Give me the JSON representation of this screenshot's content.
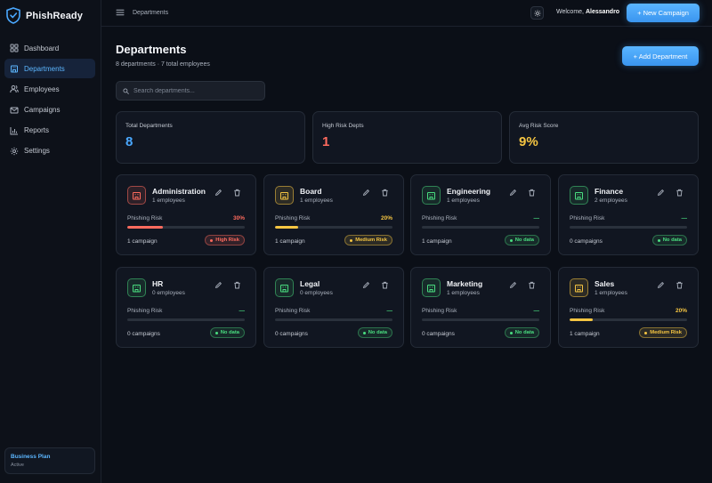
{
  "brand": {
    "name": "PhishReady"
  },
  "sidebar": {
    "items": [
      {
        "label": "Dashboard",
        "icon": "grid-icon"
      },
      {
        "label": "Departments",
        "icon": "building-icon"
      },
      {
        "label": "Employees",
        "icon": "users-icon"
      },
      {
        "label": "Campaigns",
        "icon": "mail-icon"
      },
      {
        "label": "Reports",
        "icon": "chart-icon"
      },
      {
        "label": "Settings",
        "icon": "gear-icon"
      }
    ],
    "active": "Departments",
    "plan": {
      "name": "Business Plan",
      "status": "Active"
    }
  },
  "topbar": {
    "breadcrumb": "Departments",
    "welcome_prefix": "Welcome,",
    "user": "Alessandro",
    "new_campaign_label": "+ New Campaign"
  },
  "page": {
    "title": "Departments",
    "subtitle": "8 departments · 7 total employees",
    "add_label": "+ Add Department",
    "search_placeholder": "Search departments..."
  },
  "stats": [
    {
      "label": "Total Departments",
      "value": "8",
      "color": "#4aa8ff"
    },
    {
      "label": "High Risk Depts",
      "value": "1",
      "color": "#ff6b5e"
    },
    {
      "label": "Avg Risk Score",
      "value": "9%",
      "color": "#f5c542"
    }
  ],
  "colors": {
    "accent": "#4aa8ff",
    "high": "#ff6b5e",
    "medium": "#f5c542",
    "none": "#4ade80"
  },
  "departments": [
    {
      "name": "Administration",
      "employees": "1 employees",
      "risk_label": "Phishing Risk",
      "risk_text": "30%",
      "risk": 0.3,
      "campaigns": "1 campaign",
      "badge": "High Risk",
      "level": "high"
    },
    {
      "name": "Board",
      "employees": "1 employees",
      "risk_label": "Phishing Risk",
      "risk_text": "20%",
      "risk": 0.2,
      "campaigns": "1 campaign",
      "badge": "Medium Risk",
      "level": "medium"
    },
    {
      "name": "Engineering",
      "employees": "1 employees",
      "risk_label": "Phishing Risk",
      "risk_text": "—",
      "risk": 0,
      "campaigns": "1 campaign",
      "badge": "No data",
      "level": "none"
    },
    {
      "name": "Finance",
      "employees": "2 employees",
      "risk_label": "Phishing Risk",
      "risk_text": "—",
      "risk": 0,
      "campaigns": "0 campaigns",
      "badge": "No data",
      "level": "none"
    },
    {
      "name": "HR",
      "employees": "0 employees",
      "risk_label": "Phishing Risk",
      "risk_text": "—",
      "risk": 0,
      "campaigns": "0 campaigns",
      "badge": "No data",
      "level": "none"
    },
    {
      "name": "Legal",
      "employees": "0 employees",
      "risk_label": "Phishing Risk",
      "risk_text": "—",
      "risk": 0,
      "campaigns": "0 campaigns",
      "badge": "No data",
      "level": "none"
    },
    {
      "name": "Marketing",
      "employees": "1 employees",
      "risk_label": "Phishing Risk",
      "risk_text": "—",
      "risk": 0,
      "campaigns": "0 campaigns",
      "badge": "No data",
      "level": "none"
    },
    {
      "name": "Sales",
      "employees": "1 employees",
      "risk_label": "Phishing Risk",
      "risk_text": "20%",
      "risk": 0.2,
      "campaigns": "1 campaign",
      "badge": "Medium Risk",
      "level": "medium"
    }
  ]
}
